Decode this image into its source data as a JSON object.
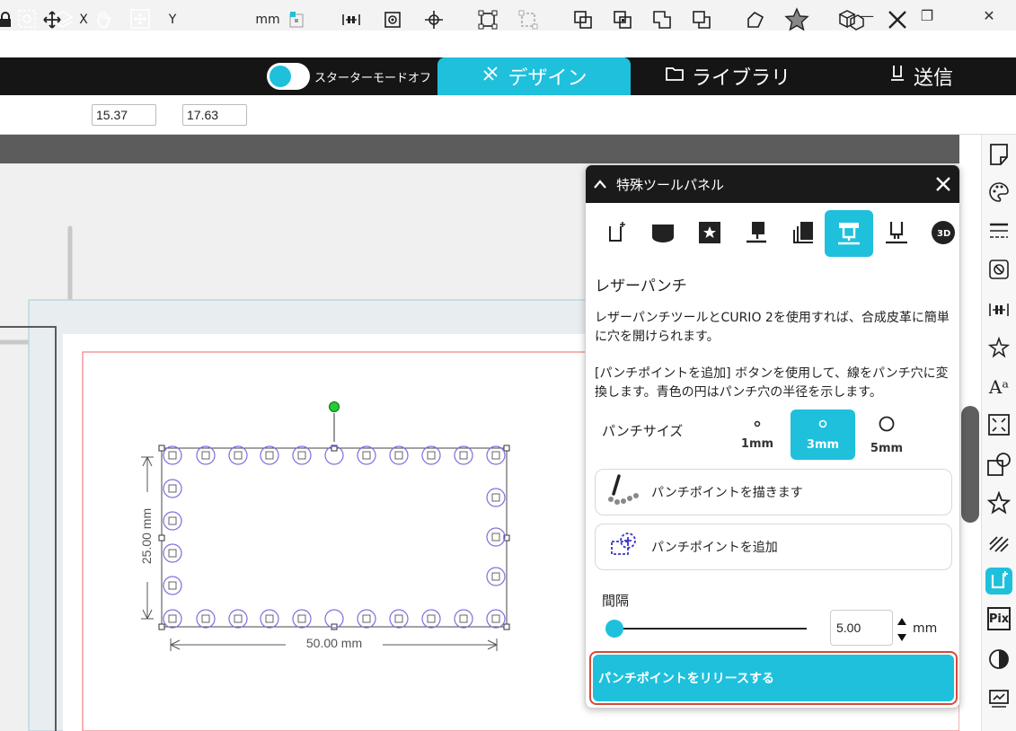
{
  "window": {
    "minimize": "—",
    "restore": "❐",
    "close": "✕"
  },
  "topbar": {
    "starter_mode_label": "スターターモードオフ",
    "tabs": [
      {
        "label": "デザイン",
        "icon": "design-icon"
      },
      {
        "label": "ライブラリ",
        "icon": "folder-icon"
      },
      {
        "label": "送信",
        "icon": "send-icon"
      }
    ]
  },
  "toolbar": {
    "x_label": "X",
    "x_value": "15.37",
    "y_label": "Y",
    "y_value": "17.63",
    "unit": "mm"
  },
  "canvas": {
    "width_dimension": "50.00 mm",
    "height_dimension": "25.00 mm"
  },
  "panel": {
    "title": "特殊ツールパネル",
    "section_title": "レザーパンチ",
    "description1": "レザーパンチツールとCURIO 2を使用すれば、合成皮革に簡単に穴を開けられます。",
    "description2": "[パンチポイントを追加] ボタンを使用して、線をパンチ穴に変換します。青色の円はパンチ穴の半径を示します。",
    "punch_size_label": "パンチサイズ",
    "sizes": [
      {
        "label": "1mm",
        "selected": false
      },
      {
        "label": "3mm",
        "selected": true
      },
      {
        "label": "5mm",
        "selected": false
      }
    ],
    "draw_points_button": "パンチポイントを描きます",
    "add_points_button": "パンチポイントを追加",
    "spacing_label": "間隔",
    "spacing_value": "5.00",
    "spacing_unit": "mm",
    "release_button": "パンチポイントをリリースする"
  },
  "colors": {
    "accent": "#1ec0dc",
    "topbar": "#151515",
    "highlight_border": "#d6493a",
    "punch_circle": "#7b6fe0"
  }
}
